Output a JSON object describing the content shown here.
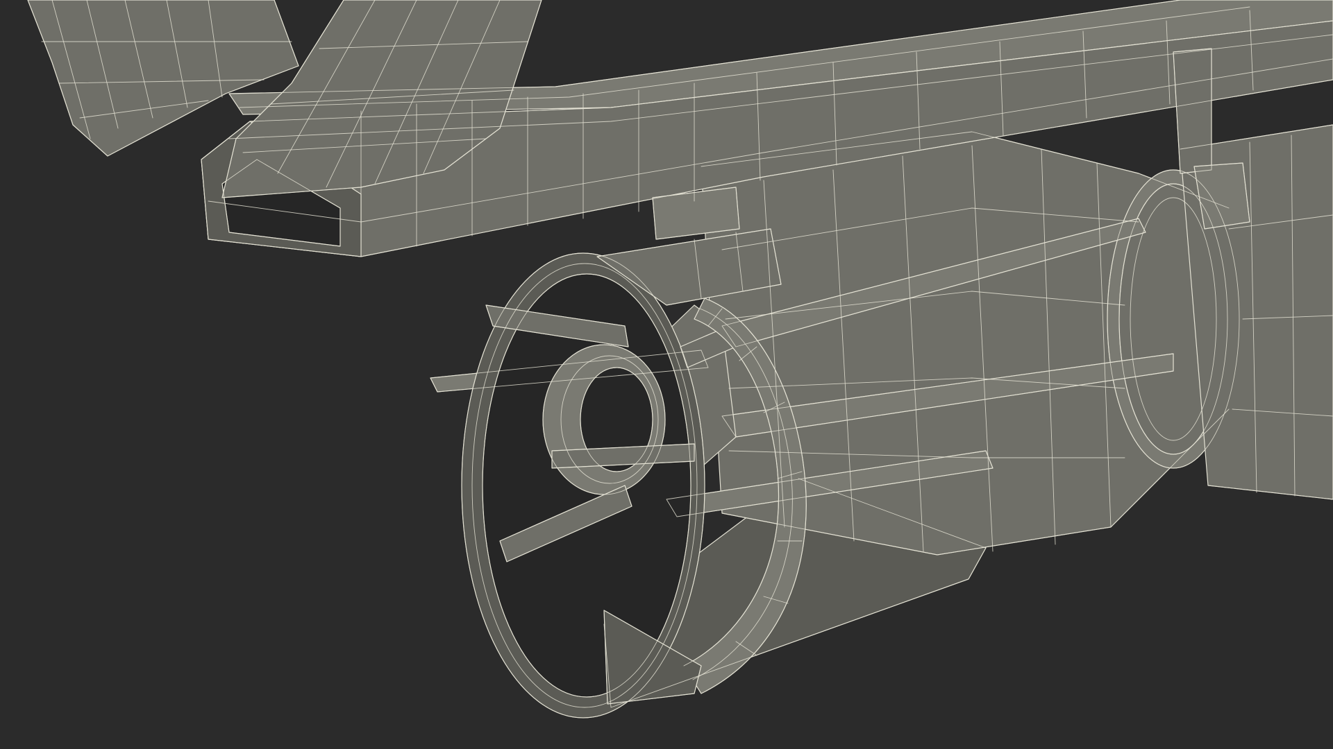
{
  "scene": {
    "background_color": "#2b2b2b",
    "surface_color": "#6f6f68",
    "surface_light_color": "#7a7a72",
    "surface_dark_color": "#5b5b55",
    "wire_color": "#e4e2d4",
    "hole_color": "#262626"
  }
}
